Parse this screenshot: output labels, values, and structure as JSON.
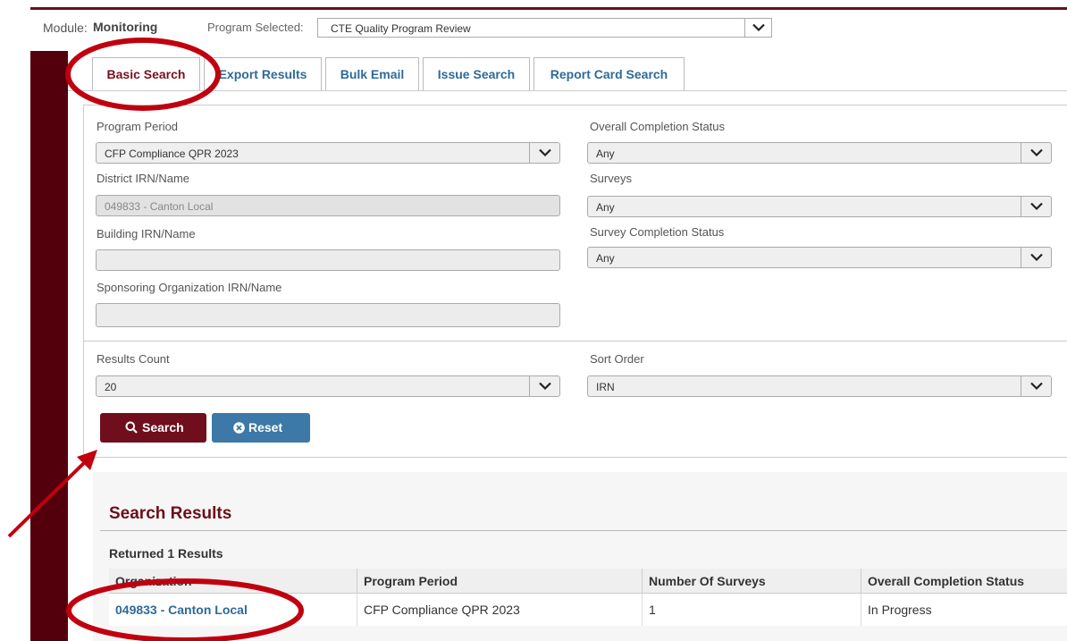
{
  "header": {
    "module_label": "Module:",
    "module_value": "Monitoring",
    "program_label": "Program Selected:",
    "program_value": "CTE Quality Program Review"
  },
  "tabs": [
    {
      "label": "Basic Search",
      "active": true
    },
    {
      "label": "Export Results",
      "active": false
    },
    {
      "label": "Bulk Email",
      "active": false
    },
    {
      "label": "Issue Search",
      "active": false
    },
    {
      "label": "Report Card Search",
      "active": false
    }
  ],
  "form": {
    "program_period": {
      "label": "Program Period",
      "value": "CFP Compliance QPR 2023"
    },
    "overall_status": {
      "label": "Overall Completion Status",
      "value": "Any"
    },
    "district": {
      "label": "District IRN/Name",
      "value": "049833 - Canton Local"
    },
    "surveys": {
      "label": "Surveys",
      "value": "Any"
    },
    "building": {
      "label": "Building IRN/Name",
      "value": ""
    },
    "survey_status": {
      "label": "Survey Completion Status",
      "value": "Any"
    },
    "sponsoring": {
      "label": "Sponsoring Organization IRN/Name",
      "value": ""
    },
    "results_count": {
      "label": "Results Count",
      "value": "20"
    },
    "sort_order": {
      "label": "Sort Order",
      "value": "IRN"
    }
  },
  "buttons": {
    "search": "Search",
    "reset": "Reset"
  },
  "results": {
    "title": "Search Results",
    "returned": "Returned 1 Results",
    "columns": [
      "Organization",
      "Program Period",
      "Number Of Surveys",
      "Overall Completion Status"
    ],
    "rows": [
      [
        "049833 - Canton Local",
        "CFP Compliance QPR 2023",
        "1",
        "In Progress"
      ]
    ]
  },
  "colors": {
    "brand_maroon": "#6b0f1a",
    "link_blue": "#2e6a99",
    "annotation_red": "#c0000f"
  },
  "icons": [
    "chevron-down-icon",
    "search-icon",
    "reset-circle-x-icon"
  ]
}
